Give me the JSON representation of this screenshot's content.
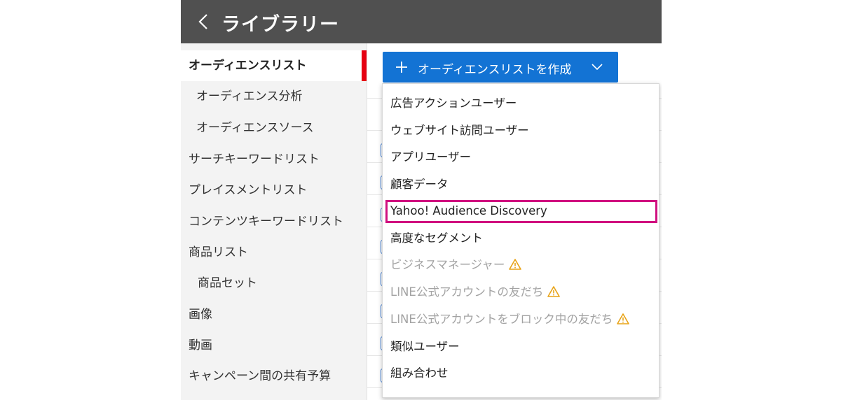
{
  "header": {
    "title": "ライブラリー",
    "background": "#505050"
  },
  "sidebar": {
    "items": [
      {
        "label": "オーディエンスリスト",
        "active": true
      },
      {
        "label": "オーディエンス分析"
      },
      {
        "label": "オーディエンスソース"
      },
      {
        "label": "サーチキーワードリスト"
      },
      {
        "label": "プレイスメントリスト"
      },
      {
        "label": "コンテンツキーワードリスト"
      },
      {
        "label": "商品リスト"
      },
      {
        "label": "商品セット"
      },
      {
        "label": "画像"
      },
      {
        "label": "動画"
      },
      {
        "label": "キャンペーン間の共有予算"
      }
    ],
    "active_accent": "#e60012"
  },
  "toolbar": {
    "create_label": "オーディエンスリストを作成",
    "button_color": "#1373d4"
  },
  "dropdown": {
    "items": [
      {
        "label": "広告アクションユーザー"
      },
      {
        "label": "ウェブサイト訪問ユーザー"
      },
      {
        "label": "アプリユーザー"
      },
      {
        "label": "顧客データ"
      },
      {
        "label": "Yahoo! Audience Discovery",
        "highlighted": true
      },
      {
        "label": "高度なセグメント"
      },
      {
        "label": "ビジネスマネージャー",
        "disabled": true,
        "icon": "warning-icon"
      },
      {
        "label": "LINE公式アカウントの友だち",
        "disabled": true,
        "icon": "warning-icon"
      },
      {
        "label": "LINE公式アカウントをブロック中の友だち",
        "disabled": true,
        "icon": "warning-icon"
      },
      {
        "label": "類似ユーザー"
      },
      {
        "label": "組み合わせ"
      }
    ],
    "highlight_color": "#d0107f",
    "warning_color": "#e8a317"
  }
}
